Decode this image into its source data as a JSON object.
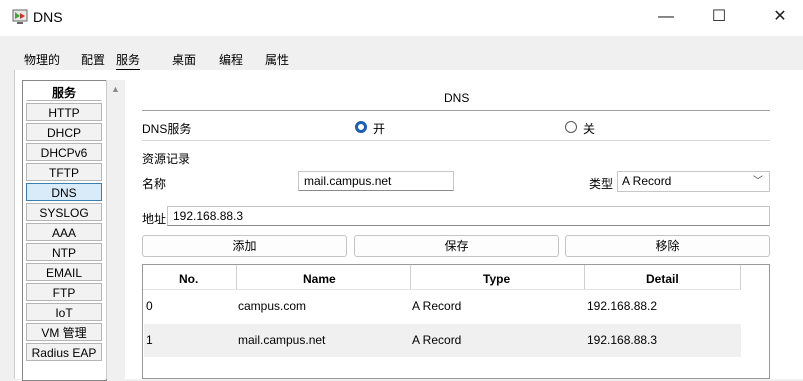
{
  "window": {
    "title": "DNS"
  },
  "tabs": [
    "物理的",
    "配置",
    "服务",
    "桌面",
    "编程",
    "属性"
  ],
  "sidebar": {
    "header": "服务",
    "items": [
      "HTTP",
      "DHCP",
      "DHCPv6",
      "TFTP",
      "DNS",
      "SYSLOG",
      "AAA",
      "NTP",
      "EMAIL",
      "FTP",
      "IoT",
      "VM 管理",
      "Radius EAP"
    ],
    "selected": "DNS"
  },
  "panel": {
    "title": "DNS",
    "dns_service_label": "DNS服务",
    "on_label": "开",
    "off_label": "关",
    "service_on": true,
    "records_label": "资源记录",
    "name_label": "名称",
    "name_value": "mail.campus.net",
    "type_label": "类型",
    "type_value": "A Record",
    "address_label": "地址",
    "address_value": "192.168.88.3",
    "add_button": "添加",
    "save_button": "保存",
    "remove_button": "移除"
  },
  "table": {
    "columns": [
      "No.",
      "Name",
      "Type",
      "Detail"
    ],
    "rows": [
      {
        "no": "0",
        "name": "campus.com",
        "type": "A Record",
        "detail": "192.168.88.2"
      },
      {
        "no": "1",
        "name": "mail.campus.net",
        "type": "A Record",
        "detail": "192.168.88.3"
      }
    ]
  }
}
